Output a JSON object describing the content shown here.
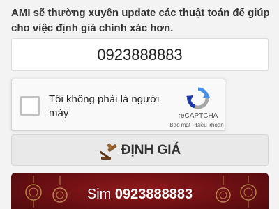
{
  "intro_text": "AMI sẽ thường xuyên update các thuật toán để giúp cho việc định giá chính xác hơn.",
  "phone_input": {
    "value": "0923888883"
  },
  "recaptcha": {
    "label": "Tôi không phải là người máy",
    "brand": "reCAPTCHA",
    "privacy_link": "Bảo mật",
    "separator": " - ",
    "terms_link": "Điều khoản",
    "checked": false
  },
  "valuate_button": {
    "label": "ĐỊNH GIÁ",
    "icon": "gavel-icon"
  },
  "sim_card": {
    "prefix": "Sim",
    "number": "0923888883"
  },
  "colors": {
    "card_red": "#8e1a1c",
    "lantern_gold": "#c9a15a",
    "recaptcha_blue": "#4a90e2",
    "recaptcha_gray": "#a6a6a6"
  }
}
